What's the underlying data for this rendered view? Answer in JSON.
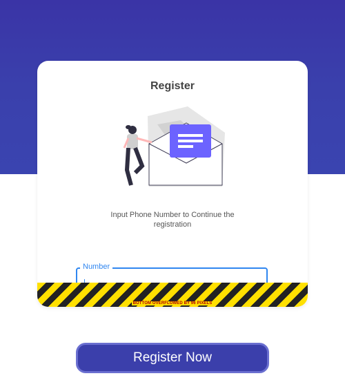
{
  "register_card": {
    "title": "Register",
    "subtitle": "Input Phone Number to Continue the registration",
    "number_field": {
      "label": "Number",
      "value": ""
    },
    "overflow_message": "BOTTOM OVERFLOWED BY 96 PIXELS"
  },
  "register_button": {
    "label": "Register Now"
  },
  "colors": {
    "header_bg": "#3a40ac",
    "accent": "#2f86f0",
    "button_bg": "#3b3fab",
    "illustration_purple": "#6c63ff"
  }
}
